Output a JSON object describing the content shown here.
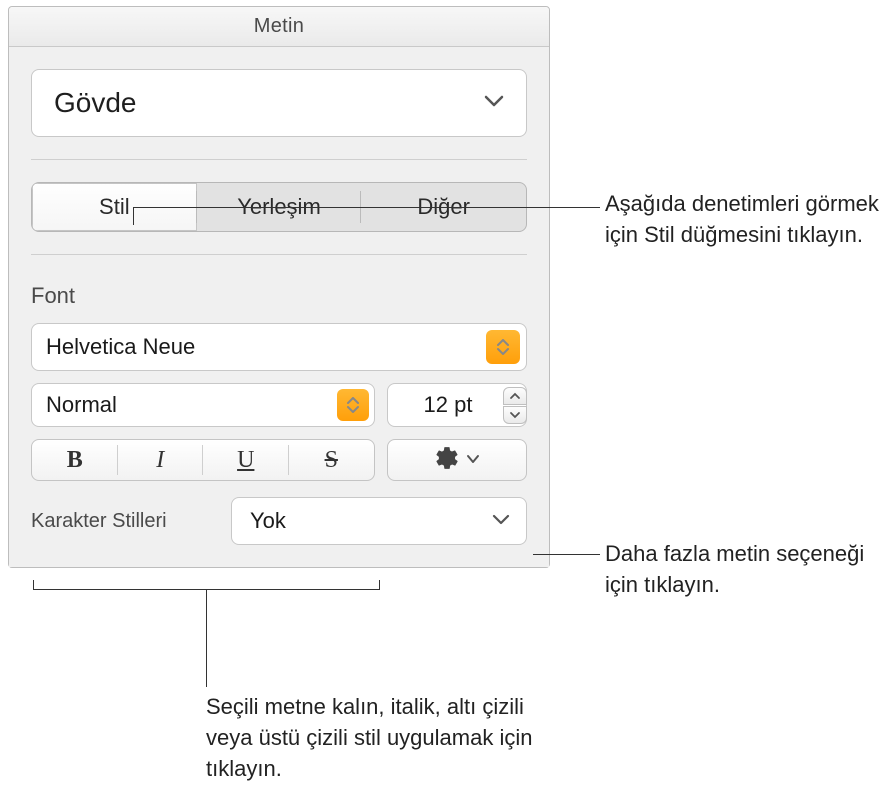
{
  "panel": {
    "title": "Metin",
    "paragraphStyle": "Gövde",
    "tabs": {
      "style": "Stil",
      "layout": "Yerleşim",
      "more": "Diğer"
    },
    "fontSection": {
      "heading": "Font",
      "fontFamily": "Helvetica Neue",
      "fontWeight": "Normal",
      "fontSize": "12 pt"
    },
    "formatButtons": {
      "bold": "B",
      "italic": "I",
      "underline": "U",
      "strike": "S"
    },
    "characterStyles": {
      "label": "Karakter Stilleri",
      "value": "Yok"
    }
  },
  "callouts": {
    "styleTab": "Aşağıda denetimleri görmek için Stil düğmesini tıklayın.",
    "gear": "Daha fazla metin seçeneği için tıklayın.",
    "biu": "Seçili metne kalın, italik, altı çizili veya üstü çizili stil uygulamak için tıklayın."
  }
}
